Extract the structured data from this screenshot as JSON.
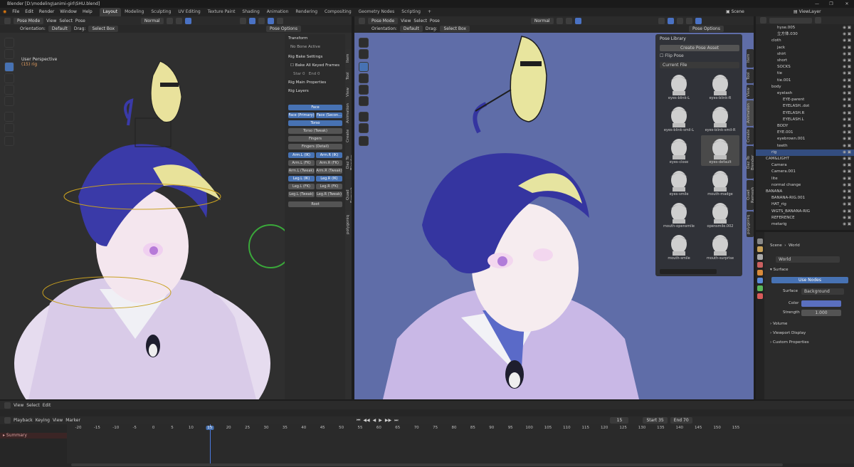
{
  "window": {
    "title": "Blender [D:\\modeling\\animi-girl\\SHU.blend]",
    "controls": [
      "—",
      "❐",
      "✕"
    ]
  },
  "menu": {
    "items": [
      "File",
      "Edit",
      "Render",
      "Window",
      "Help"
    ]
  },
  "workspaces": {
    "tabs": [
      "Layout",
      "Modeling",
      "Sculpting",
      "UV Editing",
      "Texture Paint",
      "Shading",
      "Animation",
      "Rendering",
      "Compositing",
      "Geometry Nodes",
      "Scripting"
    ],
    "active": "Layout",
    "add": "+"
  },
  "topright": {
    "scene": "Scene",
    "viewlayer": "ViewLayer"
  },
  "viewport_left": {
    "mode": "Pose Mode",
    "menus": [
      "View",
      "Select",
      "Pose"
    ],
    "shading": "Normal",
    "orientation_label": "Orientation:",
    "orientation": "Default",
    "drag_label": "Drag:",
    "drag": "Select Box",
    "pose_options": "Pose Options",
    "overlay_title": "User Perspective",
    "overlay_subtitle": "(15) rig"
  },
  "npanel": {
    "transform": "Transform",
    "no_bone": "No Bone Active",
    "rig_bake": "Rig Bake Settings",
    "bake_all": "Bake All Keyed Frames",
    "star": "Star",
    "star_val": "0",
    "end": "End",
    "end_val": "0",
    "rig_main": "Rig Main Properties",
    "rig_layers": "Rig Layers",
    "layers": [
      "Face",
      "Face (Primary)",
      "Face (Secon...",
      "Torso",
      "Torso (Tweak)",
      "Fingers",
      "Fingers (Detail)",
      "Arm.L (IK)",
      "Arm.R (IK)",
      "Arm.L (FK)",
      "Arm.R (FK)",
      "Arm.L (Tweak)",
      "Arm.R (Tweak)",
      "Leg.L (IK)",
      "Leg.R (IK)",
      "Leg.L (FK)",
      "Leg.R (FK)",
      "Leg.L (Tweak)",
      "Leg.R (Tweak)",
      "Root"
    ],
    "tabs_left": [
      "Item",
      "Tool",
      "View",
      "Animation",
      "Create",
      "Daz To Blender",
      "Quad Remesh",
      "polygoniq"
    ]
  },
  "viewport_right": {
    "mode": "Pose Mode",
    "menus": [
      "View",
      "Select",
      "Pose"
    ],
    "shading": "Normal",
    "orientation_label": "Orientation:",
    "orientation": "Default",
    "drag_label": "Drag:",
    "drag": "Select Box",
    "pose_options": "Pose Options",
    "tabs": [
      "Item",
      "Tool",
      "View",
      "Animation",
      "Create",
      "Daz To Blender",
      "Quad Remesh",
      "polygoniq"
    ]
  },
  "pose_library": {
    "title": "Pose Library",
    "create": "Create Pose Asset",
    "flip": "Flip Pose",
    "source": "Current File",
    "poses": [
      "eyes-blink-L",
      "eyes-blink-R",
      "eyes-blink-smil-L",
      "eyes-blink-smil-R",
      "eyes-close",
      "eyes-default",
      "eyes-smile",
      "mouth-madge",
      "mouth-opensmile",
      "mouth-opensmile.002",
      "mouth-smile",
      "mouth-surprise"
    ],
    "selected": "eyes-default"
  },
  "outliner": {
    "rows": [
      "hyse.005",
      "立方体.030",
      "cloth",
      "jack",
      "shirt",
      "short",
      "SOCKS",
      "tie",
      "tie.001",
      "body",
      "eyelash",
      "EYE-parent",
      "EYELASH..dot",
      "EYELASH.R",
      "EYELASH.L",
      "BODY",
      "EYE.001",
      "eyebrown.001",
      "teeth",
      "rig",
      "CAM&LIGHT",
      "Camera",
      "Camera.001",
      "lite",
      "normal change",
      "BANANA",
      "BANANA-RIG.001",
      "HAT_rig",
      "WGTS_BANANA-RIG",
      "REFERENCE",
      "metarig"
    ],
    "selected": "rig"
  },
  "properties": {
    "breadcrumb_scene": "Scene",
    "breadcrumb_world": "World",
    "world": "World",
    "surface": "Surface",
    "use_nodes": "Use Nodes",
    "surface_label": "Surface",
    "surface_val": "Background",
    "color_label": "Color",
    "strength_label": "Strength",
    "strength_val": "1.000",
    "sections": [
      "Volume",
      "Viewport Display",
      "Custom Properties"
    ],
    "world_color": "#5a6fbf"
  },
  "timeline": {
    "menus": [
      "View",
      "Select",
      "Edit"
    ],
    "menus2": [
      "Playback",
      "Keying",
      "View",
      "Marker"
    ],
    "current": "15",
    "start_label": "Start",
    "start": "35",
    "end_label": "End",
    "end": "70",
    "summary": "Summary",
    "ticks": [
      "-20",
      "-15",
      "-10",
      "-5",
      "0",
      "5",
      "10",
      "15",
      "20",
      "25",
      "30",
      "35",
      "40",
      "45",
      "50",
      "55",
      "60",
      "65",
      "70",
      "75",
      "80",
      "85",
      "90",
      "95",
      "100",
      "105",
      "110",
      "115",
      "120",
      "125",
      "130",
      "135",
      "140",
      "145",
      "150",
      "155"
    ]
  }
}
